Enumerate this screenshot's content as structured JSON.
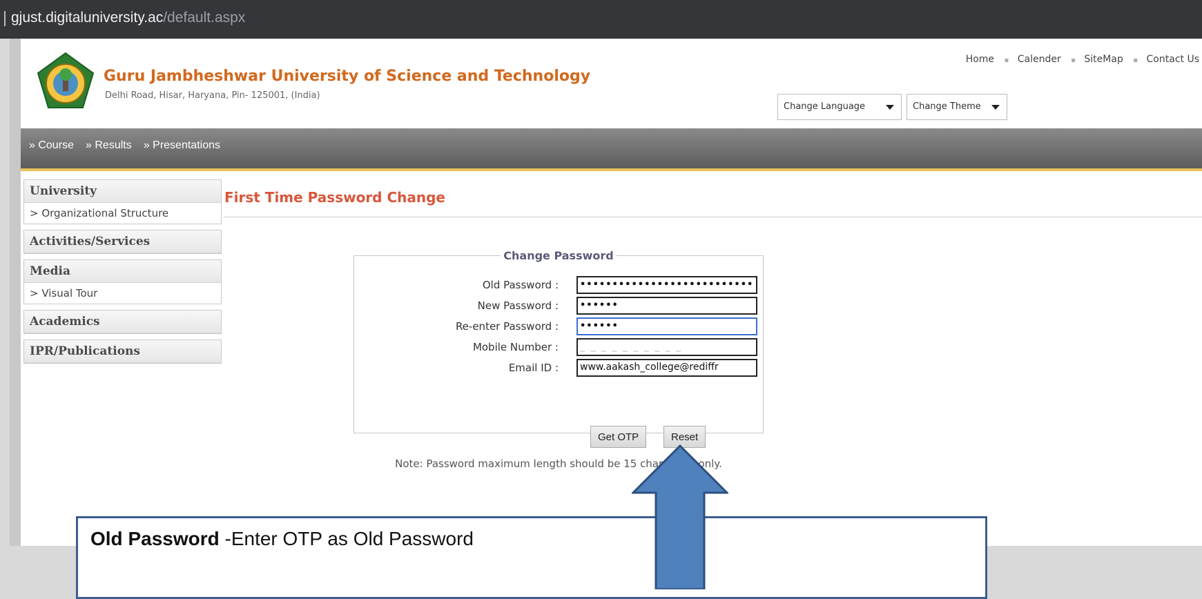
{
  "browser": {
    "url_host": "gjust.digitaluniversity.ac",
    "url_path": "/default.aspx"
  },
  "header": {
    "university_name": "Guru Jambheshwar University of Science and Technology",
    "address": "Delhi Road, Hisar, Haryana, Pin- 125001, (India)",
    "top_links": [
      "Home",
      "Calender",
      "SiteMap",
      "Contact Us"
    ],
    "language_dropdown": "Change Language",
    "theme_dropdown": "Change Theme"
  },
  "nav": {
    "items": [
      "» Course",
      "» Results",
      "» Presentations"
    ]
  },
  "sidebar": {
    "groups": [
      {
        "title": "University",
        "items": [
          "> Organizational Structure"
        ]
      },
      {
        "title": "Activities/Services",
        "items": []
      },
      {
        "title": "Media",
        "items": [
          "> Visual Tour"
        ]
      },
      {
        "title": "Academics",
        "items": []
      },
      {
        "title": "IPR/Publications",
        "items": []
      }
    ]
  },
  "main": {
    "page_title": "First Time Password Change",
    "form": {
      "legend": "Change Password",
      "old_password_label": "Old Password :",
      "old_password_value": "•••••••••••••••••••••••••••",
      "new_password_label": "New Password :",
      "new_password_value": "••••••",
      "reenter_password_label": "Re-enter Password :",
      "reenter_password_value": "••••••",
      "mobile_label": "Mobile Number :",
      "mobile_value": "_ _ _ _ _ _ _ _ _ _",
      "email_label": "Email ID :",
      "email_value": "www.aakash_college@rediffr",
      "get_otp_label": "Get OTP",
      "reset_label": "Reset",
      "note": "Note: Password maximum length should be 15 characters only."
    }
  },
  "annotation": {
    "bold_text": "Old Password",
    "text": " -Enter OTP as Old Password"
  },
  "colors": {
    "brand_orange": "#d2691e",
    "title_red": "#d9573b",
    "callout_border": "#3a5d92",
    "arrow_fill": "#4f81bd"
  }
}
